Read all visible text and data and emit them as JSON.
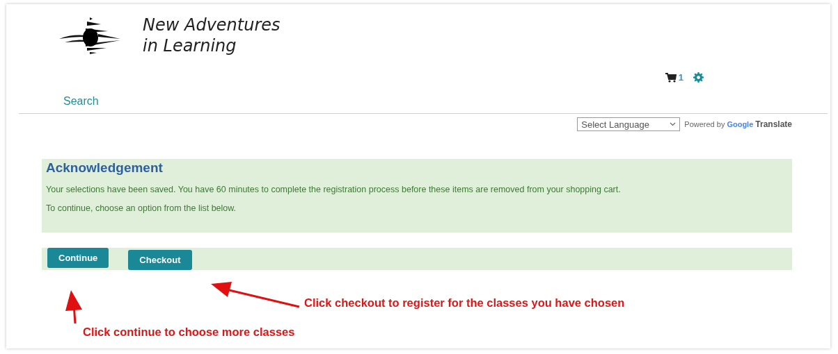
{
  "header": {
    "brand_line_1": "New Adventures",
    "brand_line_2": "in Learning",
    "cart_count": "1"
  },
  "nav": {
    "search_link": "Search"
  },
  "translate": {
    "select_placeholder": "Select Language",
    "powered_by": "Powered by",
    "google": "Google",
    "translate": "Translate"
  },
  "acknowledgement": {
    "title": "Acknowledgement",
    "message": "Your selections have been saved. You have 60 minutes to complete the registration process before these items are removed from your shopping cart.",
    "instruction": "To continue, choose an option from the list below."
  },
  "buttons": [
    "Continue",
    "Checkout"
  ],
  "annotations": [
    {
      "text": "Click checkout to register for the classes you have chosen",
      "kind": "left"
    },
    {
      "text": "Click continue to choose more classes",
      "kind": "up"
    }
  ]
}
